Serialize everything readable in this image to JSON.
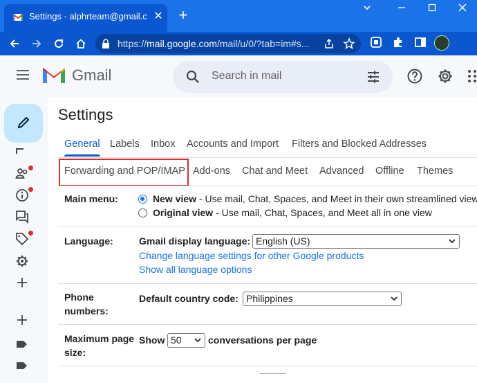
{
  "browser": {
    "tab_title": "Settings - alphrteam@gmail.com",
    "tab_close": "✕",
    "new_tab": "+",
    "url_prefix": "https://",
    "url_host": "mail.google.com",
    "url_path": "/mail/u/0/?tab=im#s..."
  },
  "header": {
    "app_name": "Gmail",
    "search_placeholder": "Search in mail"
  },
  "settings": {
    "title": "Settings",
    "tabs_row1": [
      {
        "label": "General",
        "active": true
      },
      {
        "label": "Labels"
      },
      {
        "label": "Inbox"
      },
      {
        "label": "Accounts and Import"
      },
      {
        "label": "Filters and Blocked Addresses"
      }
    ],
    "tabs_row2": [
      {
        "label": "Forwarding and POP/IMAP"
      },
      {
        "label": "Add-ons"
      },
      {
        "label": "Chat and Meet"
      },
      {
        "label": "Advanced"
      },
      {
        "label": "Offline"
      },
      {
        "label": "Themes"
      }
    ],
    "main_menu": {
      "label": "Main menu:",
      "new_view_title": "New view",
      "new_view_desc": " - Use mail, Chat, Spaces, and Meet in their own streamlined view",
      "original_view_title": "Original view",
      "original_view_desc": " - Use mail, Chat, Spaces, and Meet all in one view"
    },
    "language": {
      "label": "Language:",
      "display_label": "Gmail display language:",
      "value": "English (US)",
      "link1": "Change language settings for other Google products",
      "link2": "Show all language options"
    },
    "phone": {
      "label_line1": "Phone",
      "label_line2": "numbers:",
      "country_label": "Default country code:",
      "value": "Philippines"
    },
    "page_size": {
      "label_line1": "Maximum page",
      "label_line2": "size:",
      "show": "Show",
      "value": "50",
      "suffix": "conversations per page"
    }
  }
}
